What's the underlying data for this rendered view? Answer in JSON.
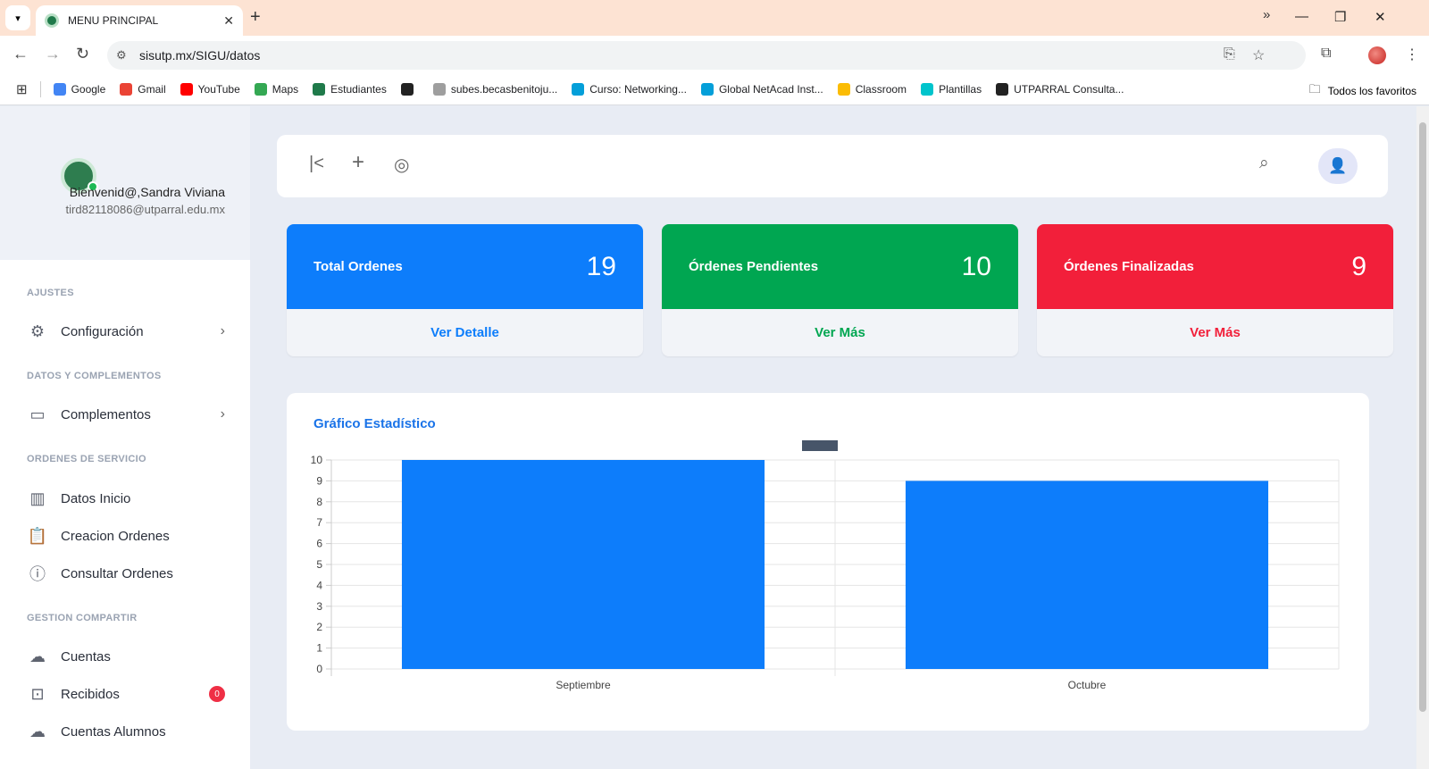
{
  "browser": {
    "tab_title": "MENU PRINCIPAL",
    "url": "sisutp.mx/SIGU/datos",
    "bookmarks": [
      {
        "label": "Google",
        "color": "#4285f4"
      },
      {
        "label": "Gmail",
        "color": "#ea4335"
      },
      {
        "label": "YouTube",
        "color": "#ff0000"
      },
      {
        "label": "Maps",
        "color": "#34a853"
      },
      {
        "label": "Estudiantes",
        "color": "#1f7a4a"
      },
      {
        "label": "",
        "color": "#222222"
      },
      {
        "label": "subes.becasbenitoju...",
        "color": "#9e9e9e"
      },
      {
        "label": "Curso: Networking...",
        "color": "#049fd9"
      },
      {
        "label": "Global NetAcad Inst...",
        "color": "#049fd9"
      },
      {
        "label": "Classroom",
        "color": "#fbbc04"
      },
      {
        "label": "Plantillas",
        "color": "#00c4cc"
      },
      {
        "label": "UTPARRAL Consulta...",
        "color": "#222222"
      }
    ],
    "all_bookmarks": "Todos los favoritos"
  },
  "user": {
    "welcome": "Bienvenid@,Sandra Viviana",
    "email": "tird82118086@utparral.edu.mx"
  },
  "sidebar": {
    "sections": [
      {
        "title": "AJUSTES",
        "items": [
          {
            "label": "Configuración",
            "icon": "gear-icon",
            "arrow": true
          }
        ]
      },
      {
        "title": "DATOS Y COMPLEMENTOS",
        "items": [
          {
            "label": "Complementos",
            "icon": "calendar-icon",
            "arrow": true
          }
        ]
      },
      {
        "title": "ORDENES DE SERVICIO",
        "items": [
          {
            "label": "Datos Inicio",
            "icon": "bar-chart-icon"
          },
          {
            "label": "Creacion Ordenes",
            "icon": "clipboard-clock-icon"
          },
          {
            "label": "Consultar Ordenes",
            "icon": "info-icon"
          }
        ]
      },
      {
        "title": "GESTION COMPARTIR",
        "items": [
          {
            "label": "Cuentas",
            "icon": "cloud-icon"
          },
          {
            "label": "Recibidos",
            "icon": "inbox-icon",
            "badge": "0"
          },
          {
            "label": "Cuentas Alumnos",
            "icon": "cloud-icon"
          }
        ]
      }
    ]
  },
  "stats": [
    {
      "label": "Total Ordenes",
      "value": "19",
      "link": "Ver Detalle",
      "color": "#0d7dfb"
    },
    {
      "label": "Órdenes Pendientes",
      "value": "10",
      "link": "Ver Más",
      "color": "#00a651"
    },
    {
      "label": "Órdenes Finalizadas",
      "value": "9",
      "link": "Ver Más",
      "color": "#f21f3a"
    }
  ],
  "chart_section": {
    "title": "Gráfico Estadístico"
  },
  "chart_data": {
    "type": "bar",
    "categories": [
      "Septiembre",
      "Octubre"
    ],
    "values": [
      10,
      9
    ],
    "ylim": [
      0,
      10
    ],
    "yticks": [
      "0",
      "1",
      "2",
      "3",
      "4",
      "5",
      "6",
      "7",
      "8",
      "9",
      "10"
    ],
    "grid": true,
    "bar_color": "#0d7dfb",
    "legend_color": "#475569"
  }
}
